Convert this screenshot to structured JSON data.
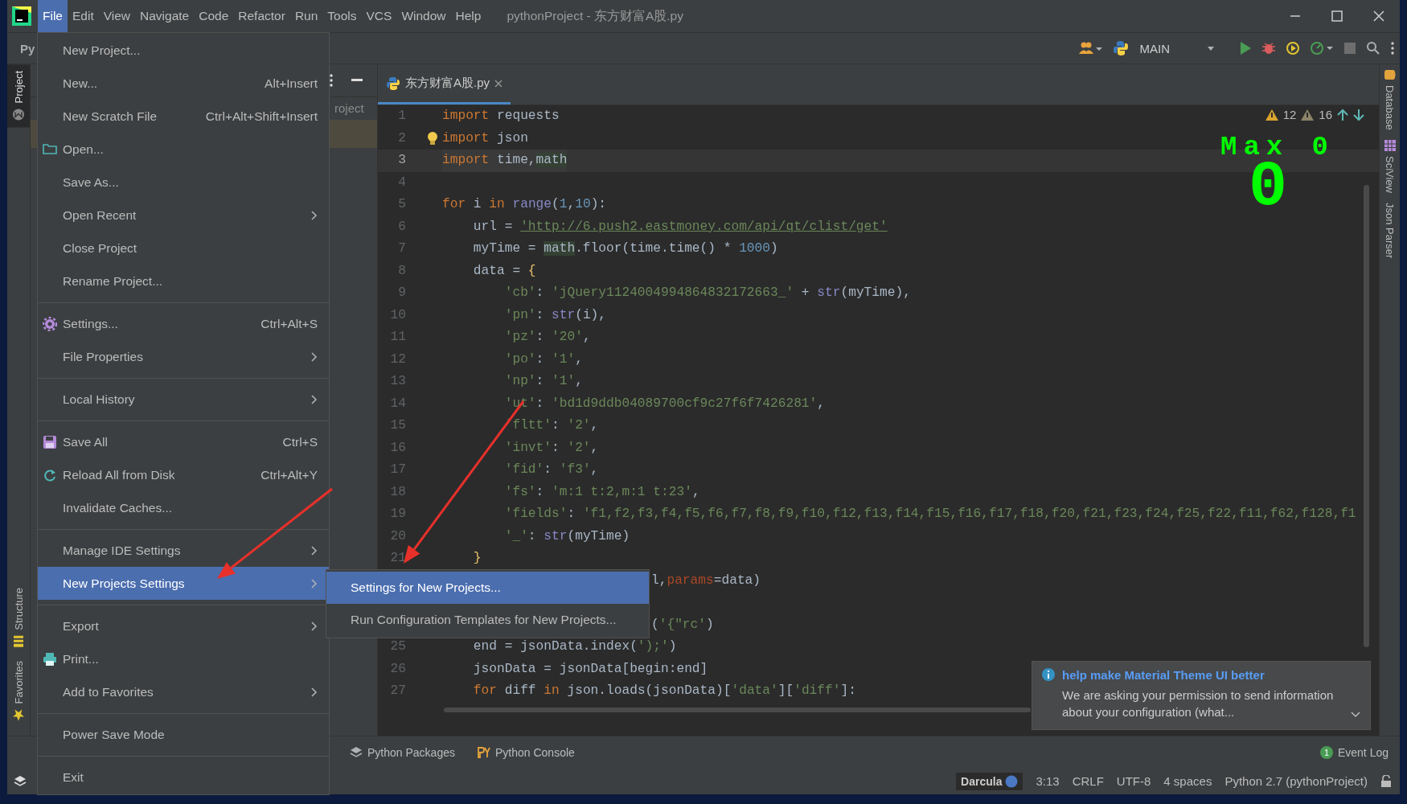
{
  "menu_bar": {
    "items": [
      {
        "label": "File",
        "selected": true
      },
      {
        "label": "Edit",
        "selected": false
      },
      {
        "label": "View",
        "selected": false
      },
      {
        "label": "Navigate",
        "selected": false
      },
      {
        "label": "Code",
        "selected": false
      },
      {
        "label": "Refactor",
        "selected": false
      },
      {
        "label": "Run",
        "selected": false
      },
      {
        "label": "Tools",
        "selected": false
      },
      {
        "label": "VCS",
        "selected": false
      },
      {
        "label": "Window",
        "selected": false
      },
      {
        "label": "Help",
        "selected": false
      }
    ]
  },
  "window": {
    "title": "pythonProject - 东方财富A股.py"
  },
  "toolbar": {
    "breadcrumb": "Py",
    "run_config": "MAIN"
  },
  "left_strip": {
    "top": [
      {
        "label": "Project",
        "selected": true
      }
    ],
    "bottom": [
      {
        "label": "Structure",
        "selected": false
      },
      {
        "label": "Favorites",
        "selected": false
      }
    ]
  },
  "project_panel": {
    "tree_text": "roject"
  },
  "editor": {
    "tab": {
      "label": "东方财富A股.py",
      "selected": true
    },
    "inspections": {
      "errors": "12",
      "warnings": "16"
    },
    "lines": [
      {
        "number": "1",
        "current": false,
        "tokens": [
          {
            "kind": "keyword",
            "text": "import"
          },
          {
            "kind": "plain",
            "text": " requests"
          }
        ]
      },
      {
        "number": "2",
        "current": false,
        "tokens": [
          {
            "kind": "keyword",
            "text": "import"
          },
          {
            "kind": "plain",
            "text": " json"
          }
        ]
      },
      {
        "number": "3",
        "current": true,
        "tokens": [
          {
            "kind": "keyword",
            "text": "import"
          },
          {
            "kind": "plain",
            "text": " time,"
          },
          {
            "kind": "highlight",
            "text": "math"
          }
        ]
      },
      {
        "number": "4",
        "current": false
      },
      {
        "number": "5",
        "current": false,
        "tokens": [
          {
            "kind": "keyword",
            "text": "for"
          },
          {
            "kind": "plain",
            "text": " i "
          },
          {
            "kind": "keyword",
            "text": "in"
          },
          {
            "kind": "builtin",
            "text": " range"
          },
          {
            "kind": "plain",
            "text": "("
          },
          {
            "kind": "number",
            "text": "1"
          },
          {
            "kind": "plain",
            "text": ","
          },
          {
            "kind": "number",
            "text": "10"
          },
          {
            "kind": "plain",
            "text": "):"
          }
        ]
      },
      {
        "number": "6",
        "current": false,
        "tokens": [
          {
            "kind": "plain",
            "text": "    url = "
          },
          {
            "kind": "url",
            "text": "'http://6.push2.eastmoney.com/api/qt/clist/get'"
          }
        ]
      },
      {
        "number": "7",
        "current": false,
        "tokens": [
          {
            "kind": "plain",
            "text": "    myTime = "
          },
          {
            "kind": "highlight",
            "text": "math"
          },
          {
            "kind": "plain",
            "text": ".floor(time.time() * "
          },
          {
            "kind": "number",
            "text": "1000"
          },
          {
            "kind": "plain",
            "text": ")"
          }
        ]
      },
      {
        "number": "8",
        "current": false,
        "tokens": [
          {
            "kind": "plain",
            "text": "    data = "
          },
          {
            "kind": "brace",
            "text": "{"
          }
        ]
      },
      {
        "number": "9",
        "current": false,
        "tokens": [
          {
            "kind": "string",
            "text": "        'cb'"
          },
          {
            "kind": "plain",
            "text": ": "
          },
          {
            "kind": "string",
            "text": "'jQuery1124004994864832172663_'"
          },
          {
            "kind": "plain",
            "text": " + "
          },
          {
            "kind": "builtin",
            "text": "str"
          },
          {
            "kind": "plain",
            "text": "(myTime),"
          }
        ]
      },
      {
        "number": "10",
        "current": false,
        "tokens": [
          {
            "kind": "string",
            "text": "        'pn'"
          },
          {
            "kind": "plain",
            "text": ": "
          },
          {
            "kind": "builtin",
            "text": "str"
          },
          {
            "kind": "plain",
            "text": "(i),"
          }
        ]
      },
      {
        "number": "11",
        "current": false,
        "tokens": [
          {
            "kind": "string",
            "text": "        'pz'"
          },
          {
            "kind": "plain",
            "text": ": "
          },
          {
            "kind": "string",
            "text": "'20'"
          },
          {
            "kind": "plain",
            "text": ","
          }
        ]
      },
      {
        "number": "12",
        "current": false,
        "tokens": [
          {
            "kind": "string",
            "text": "        'po'"
          },
          {
            "kind": "plain",
            "text": ": "
          },
          {
            "kind": "string",
            "text": "'1'"
          },
          {
            "kind": "plain",
            "text": ","
          }
        ]
      },
      {
        "number": "13",
        "current": false,
        "tokens": [
          {
            "kind": "string",
            "text": "        'np'"
          },
          {
            "kind": "plain",
            "text": ": "
          },
          {
            "kind": "string",
            "text": "'1'"
          },
          {
            "kind": "plain",
            "text": ","
          }
        ]
      },
      {
        "number": "14",
        "current": false,
        "tokens": [
          {
            "kind": "string",
            "text": "        'ut'"
          },
          {
            "kind": "plain",
            "text": ": "
          },
          {
            "kind": "string",
            "text": "'bd1d9ddb04089700cf9c27f6f7426281'"
          },
          {
            "kind": "plain",
            "text": ","
          }
        ]
      },
      {
        "number": "15",
        "current": false,
        "tokens": [
          {
            "kind": "string",
            "text": "        'fltt'"
          },
          {
            "kind": "plain",
            "text": ": "
          },
          {
            "kind": "string",
            "text": "'2'"
          },
          {
            "kind": "plain",
            "text": ","
          }
        ]
      },
      {
        "number": "16",
        "current": false,
        "tokens": [
          {
            "kind": "string",
            "text": "        'invt'"
          },
          {
            "kind": "plain",
            "text": ": "
          },
          {
            "kind": "string",
            "text": "'2'"
          },
          {
            "kind": "plain",
            "text": ","
          }
        ]
      },
      {
        "number": "17",
        "current": false,
        "tokens": [
          {
            "kind": "string",
            "text": "        'fid'"
          },
          {
            "kind": "plain",
            "text": ": "
          },
          {
            "kind": "string",
            "text": "'f3'"
          },
          {
            "kind": "plain",
            "text": ","
          }
        ]
      },
      {
        "number": "18",
        "current": false,
        "tokens": [
          {
            "kind": "string",
            "text": "        'fs'"
          },
          {
            "kind": "plain",
            "text": ": "
          },
          {
            "kind": "string",
            "text": "'m:1 t:2,m:1 t:23'"
          },
          {
            "kind": "plain",
            "text": ","
          }
        ]
      },
      {
        "number": "19",
        "current": false,
        "tokens": [
          {
            "kind": "string",
            "text": "        'fields'"
          },
          {
            "kind": "plain",
            "text": ": "
          },
          {
            "kind": "string",
            "text": "'f1,f2,f3,f4,f5,f6,f7,f8,f9,f10,f12,f13,f14,f15,f16,f17,f18,f20,f21,f23,f24,f25,f22,f11,f62,f128,f1"
          }
        ]
      },
      {
        "number": "20",
        "current": false,
        "tokens": [
          {
            "kind": "string",
            "text": "        '_'"
          },
          {
            "kind": "plain",
            "text": ": "
          },
          {
            "kind": "builtin",
            "text": "str"
          },
          {
            "kind": "plain",
            "text": "(myTime)"
          }
        ]
      },
      {
        "number": "21",
        "current": false,
        "tokens": [
          {
            "kind": "brace",
            "text": "    }"
          }
        ]
      },
      {
        "kind": "partial",
        "current": false,
        "tokens": [
          {
            "kind": "plain",
            "text": "l,"
          },
          {
            "kind": "param",
            "text": "params"
          },
          {
            "kind": "plain",
            "text": "=data)"
          }
        ]
      },
      {
        "kind": "partial",
        "current": false,
        "tokens": [
          {
            "kind": "plain",
            "text": "("
          },
          {
            "kind": "string",
            "text": "'{\"rc'"
          },
          {
            "kind": "plain",
            "text": ")"
          }
        ]
      },
      {
        "number": "25",
        "current": false,
        "tokens": [
          {
            "kind": "plain",
            "text": "    end = jsonData.index("
          },
          {
            "kind": "string",
            "text": "');'"
          },
          {
            "kind": "plain",
            "text": ")"
          }
        ]
      },
      {
        "number": "26",
        "current": false,
        "tokens": [
          {
            "kind": "plain",
            "text": "    jsonData = jsonData[begin:end]"
          }
        ]
      },
      {
        "number": "27",
        "current": false,
        "tokens": [
          {
            "kind": "keyword",
            "text": "    for"
          },
          {
            "kind": "plain",
            "text": " diff "
          },
          {
            "kind": "keyword",
            "text": "in"
          },
          {
            "kind": "plain",
            "text": " json.loads(jsonData)["
          },
          {
            "kind": "string",
            "text": "'data'"
          },
          {
            "kind": "plain",
            "text": "]["
          },
          {
            "kind": "string",
            "text": "'diff'"
          },
          {
            "kind": "plain",
            "text": "]:"
          }
        ]
      }
    ]
  },
  "power_mode": {
    "label": "Max 0",
    "combo": "0"
  },
  "right_strip": [
    "Database",
    "SciView",
    "Json Parser"
  ],
  "bottom_tools": [
    "Python Packages",
    "Python Console"
  ],
  "event_log": {
    "label": "Event Log",
    "count": "1"
  },
  "status_bar": {
    "theme": "Darcula",
    "position": "3:13",
    "line_separator": "CRLF",
    "encoding": "UTF-8",
    "indent": "4 spaces",
    "interpreter": "Python 2.7 (pythonProject)"
  },
  "notification": {
    "title": "help make Material Theme UI better",
    "body": "We are asking your permission to send information about your configuration (what..."
  },
  "file_menu": {
    "items": [
      {
        "kind": "item",
        "label": "New Project...",
        "submenu": false,
        "selected": false
      },
      {
        "kind": "item",
        "label": "New...",
        "shortcut": "Alt+Insert",
        "submenu": false,
        "selected": false
      },
      {
        "kind": "item",
        "label": "New Scratch File",
        "shortcut": "Ctrl+Alt+Shift+Insert",
        "submenu": false,
        "selected": false
      },
      {
        "kind": "item",
        "label": "Open...",
        "submenu": false,
        "selected": false
      },
      {
        "kind": "item",
        "label": "Save As...",
        "submenu": false,
        "selected": false
      },
      {
        "kind": "item",
        "label": "Open Recent",
        "submenu": true,
        "selected": false
      },
      {
        "kind": "item",
        "label": "Close Project",
        "submenu": false,
        "selected": false
      },
      {
        "kind": "item",
        "label": "Rename Project...",
        "submenu": false,
        "selected": false
      },
      {
        "kind": "separator"
      },
      {
        "kind": "item",
        "label": "Settings...",
        "shortcut": "Ctrl+Alt+S",
        "submenu": false,
        "selected": false
      },
      {
        "kind": "item",
        "label": "File Properties",
        "submenu": true,
        "selected": false
      },
      {
        "kind": "separator"
      },
      {
        "kind": "item",
        "label": "Local History",
        "submenu": true,
        "selected": false
      },
      {
        "kind": "separator"
      },
      {
        "kind": "item",
        "label": "Save All",
        "shortcut": "Ctrl+S",
        "submenu": false,
        "selected": false
      },
      {
        "kind": "item",
        "label": "Reload All from Disk",
        "shortcut": "Ctrl+Alt+Y",
        "submenu": false,
        "selected": false
      },
      {
        "kind": "item",
        "label": "Invalidate Caches...",
        "submenu": false,
        "selected": false
      },
      {
        "kind": "separator"
      },
      {
        "kind": "item",
        "label": "Manage IDE Settings",
        "submenu": true,
        "selected": false
      },
      {
        "kind": "item",
        "label": "New Projects Settings",
        "submenu": true,
        "selected": true
      },
      {
        "kind": "separator"
      },
      {
        "kind": "item",
        "label": "Export",
        "submenu": true,
        "selected": false
      },
      {
        "kind": "item",
        "label": "Print...",
        "submenu": false,
        "selected": false
      },
      {
        "kind": "item",
        "label": "Add to Favorites",
        "submenu": true,
        "selected": false
      },
      {
        "kind": "separator"
      },
      {
        "kind": "item",
        "label": "Power Save Mode",
        "submenu": false,
        "selected": false
      },
      {
        "kind": "separator"
      },
      {
        "kind": "item",
        "label": "Exit",
        "submenu": false,
        "selected": false
      }
    ]
  },
  "submenu": {
    "items": [
      {
        "label": "Settings for New Projects...",
        "selected": true
      },
      {
        "label": "Run Configuration Templates for New Projects...",
        "selected": false
      }
    ]
  }
}
